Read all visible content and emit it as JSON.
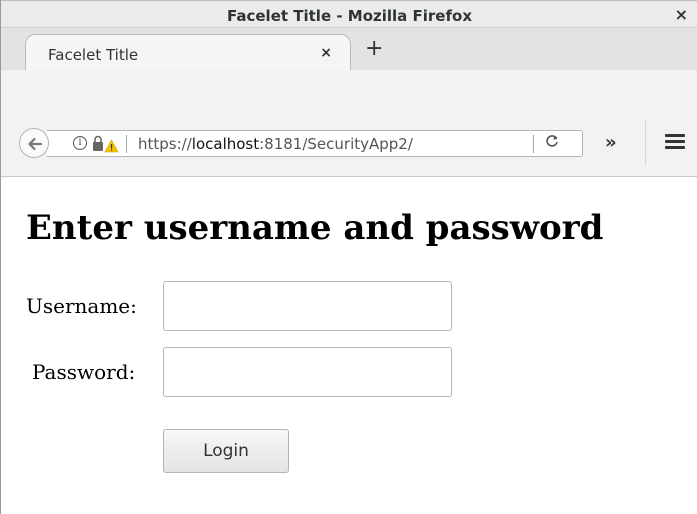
{
  "window": {
    "title": "Facelet Title - Mozilla Firefox",
    "close_glyph": "×"
  },
  "tab": {
    "label": "Facelet Title",
    "close_glyph": "×",
    "new_tab_glyph": "+"
  },
  "navbar": {
    "url_scheme": "https://",
    "url_host": "localhost",
    "url_rest": ":8181/SecurityApp2/",
    "info_glyph": "i",
    "reload_glyph": "C",
    "overflow_glyph": "»",
    "icons": [
      "back-arrow-icon",
      "info-icon",
      "insecure-lock-warning-icon",
      "reload-icon",
      "overflow-chevron-icon",
      "hamburger-menu-icon"
    ],
    "warning_color": "#f7c600"
  },
  "page": {
    "heading": "Enter username and password",
    "username_label": "Username:",
    "password_label": "Password:",
    "username_value": "",
    "password_value": "",
    "login_label": "Login"
  }
}
